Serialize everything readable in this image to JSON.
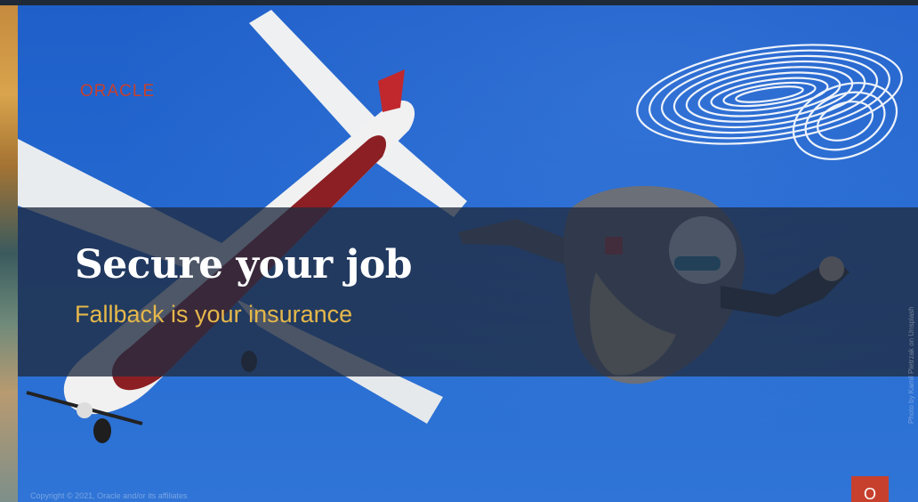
{
  "slide": {
    "logo_text": "ORACLE",
    "title": "Secure your job",
    "subtitle": "Fallback is your insurance",
    "copyright": "Copyright © 2021, Oracle and/or its affiliates",
    "photo_credit": "Photo by Kamil Pietrzak on Unsplash",
    "badge_text": "O"
  },
  "colors": {
    "sky": "#2367cf",
    "band": "#202c40",
    "title": "#ffffff",
    "subtitle": "#e6b84a",
    "brand_red": "#c7402d"
  },
  "images": {
    "background": "skydiver-and-airplane-photo",
    "decoration": "fingerprint-swirl-graphic"
  }
}
